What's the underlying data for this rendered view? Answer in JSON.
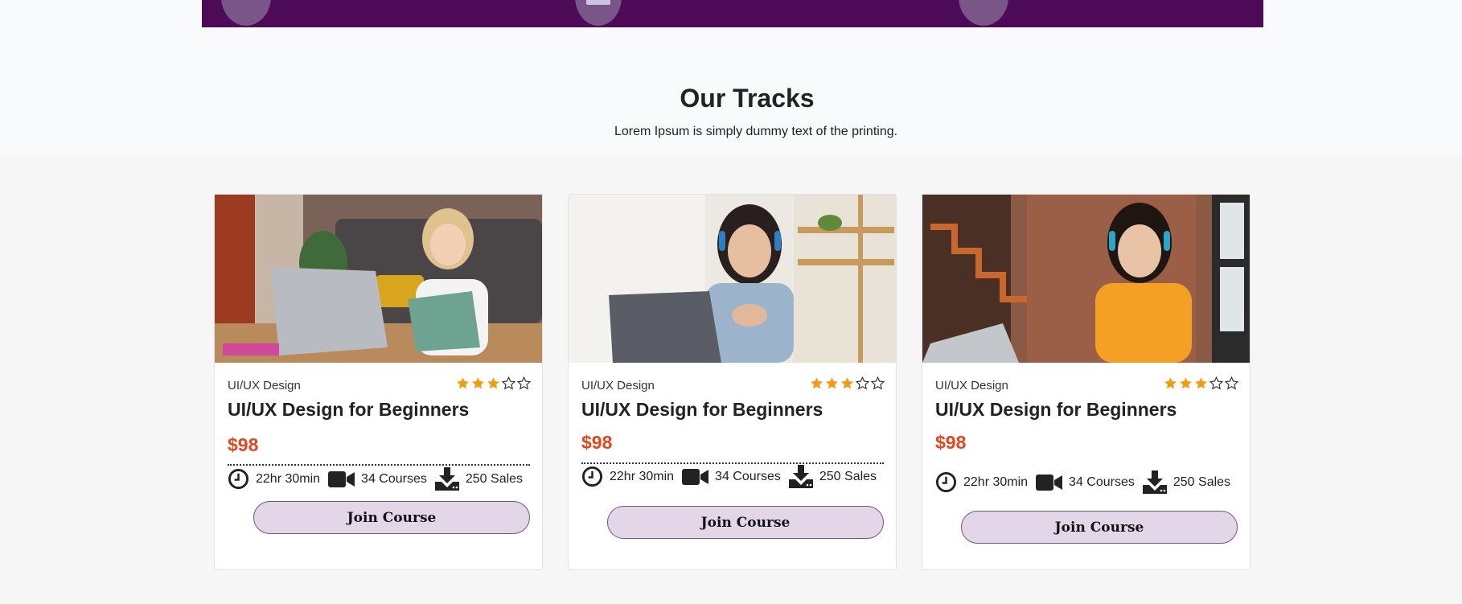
{
  "section": {
    "title": "Our Tracks",
    "subtitle": "Lorem Ipsum is simply dummy text of the printing."
  },
  "colors": {
    "hero": "#4c0a57",
    "price": "#e0481f",
    "star_filled": "#f39c12",
    "button_bg": "#e3d6e9"
  },
  "cards": [
    {
      "category": "UI/UX Design",
      "rating": 3,
      "rating_max": 5,
      "title": "UI/UX Design for Beginners",
      "price": "$98",
      "duration": "22hr 30min",
      "courses": "34 Courses",
      "sales": "250 Sales",
      "button": "Join Course",
      "icons": [
        "clock-icon",
        "video-camera-icon",
        "download-icon"
      ]
    },
    {
      "category": "UI/UX Design",
      "rating": 3,
      "rating_max": 5,
      "title": "UI/UX Design for Beginners",
      "price": "$98",
      "duration": "22hr 30min",
      "courses": "34 Courses",
      "sales": "250 Sales",
      "button": "Join Course",
      "icons": [
        "clock-icon",
        "video-camera-icon",
        "download-icon"
      ]
    },
    {
      "category": "UI/UX Design",
      "rating": 3,
      "rating_max": 5,
      "title": "UI/UX Design for Beginners",
      "price": "$98",
      "duration": "22hr 30min",
      "courses": "34 Courses",
      "sales": "250 Sales",
      "button": "Join Course",
      "icons": [
        "clock-icon",
        "video-camera-icon",
        "download-icon"
      ]
    }
  ]
}
